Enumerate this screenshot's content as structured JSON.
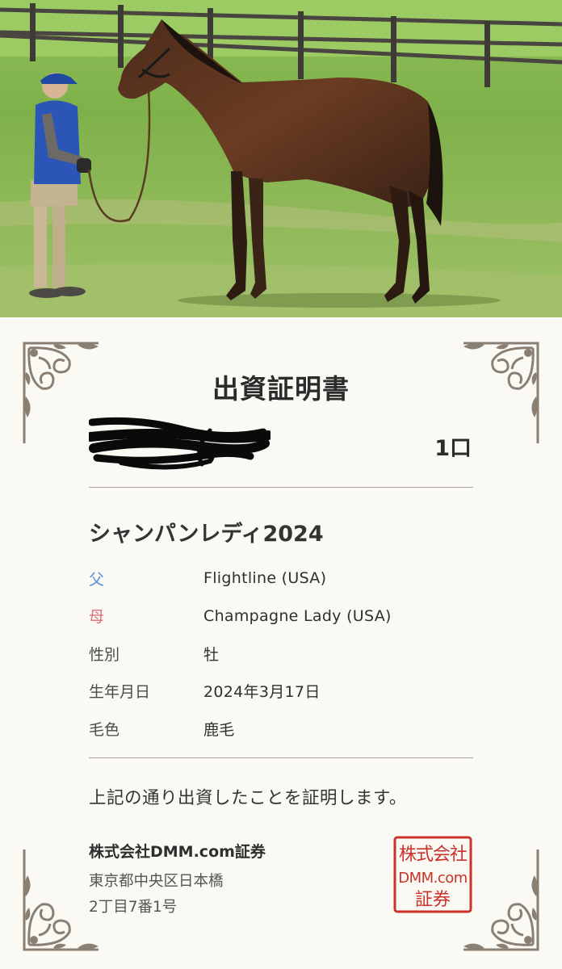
{
  "certificate": {
    "title": "出資証明書",
    "units": "1口",
    "horse_name": "シャンパンレディ2024",
    "details": [
      {
        "label": "父",
        "value": "Flightline (USA)",
        "label_color": "#5b8ed8"
      },
      {
        "label": "母",
        "value": "Champagne Lady (USA)",
        "label_color": "#d9707a"
      },
      {
        "label": "性別",
        "value": "牡"
      },
      {
        "label": "生年月日",
        "value": "2024年3月17日"
      },
      {
        "label": "毛色",
        "value": "鹿毛"
      }
    ],
    "statement": "上記の通り出資したことを証明します。",
    "company": "株式会社DMM.com証券",
    "address_line1": "東京都中央区日本橋",
    "address_line2": "2丁目7番1号",
    "seal": {
      "line1": "株式会社",
      "line2": "DMM.com",
      "line3": "証券"
    }
  },
  "colors": {
    "background": "#fbf9f3",
    "sire_label": "#5b8ed8",
    "dam_label": "#d9707a",
    "seal_red": "#c8322a",
    "ornament": "#8a7f73"
  },
  "icons": {
    "corner_ornament": "scroll-ornament-icon",
    "redaction": "scribble-redaction"
  }
}
